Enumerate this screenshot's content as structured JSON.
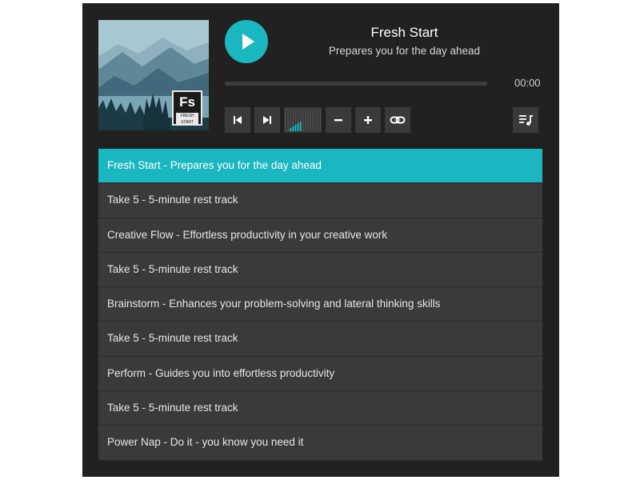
{
  "album": {
    "badge_letters": "Fs",
    "badge_caption": "FRESH START"
  },
  "now_playing": {
    "title": "Fresh Start",
    "subtitle": "Prepares you for the day ahead",
    "time": "00:00",
    "progress_fraction": 0,
    "volume_fraction": 0.5
  },
  "controls": {
    "play_icon": "play-icon",
    "prev_icon": "skip-previous-icon",
    "next_icon": "skip-next-icon",
    "volume_down_icon": "minus-icon",
    "volume_up_icon": "plus-icon",
    "loop_icon": "loop-icon",
    "playlist_icon": "playlist-music-icon"
  },
  "colors": {
    "accent": "#1ab7c1",
    "panel": "#212121",
    "row": "#3a3a3a"
  },
  "playlist": [
    {
      "label": "Fresh Start - Prepares you for the day ahead",
      "active": true
    },
    {
      "label": "Take 5 - 5-minute rest track",
      "active": false
    },
    {
      "label": "Creative Flow - Effortless productivity in your creative work",
      "active": false
    },
    {
      "label": "Take 5 - 5-minute rest track",
      "active": false
    },
    {
      "label": "Brainstorm - Enhances your problem-solving and lateral thinking skills",
      "active": false
    },
    {
      "label": "Take 5 - 5-minute rest track",
      "active": false
    },
    {
      "label": "Perform - Guides you into effortless productivity",
      "active": false
    },
    {
      "label": "Take 5 - 5-minute rest track",
      "active": false
    },
    {
      "label": "Power Nap - Do it - you know you need it",
      "active": false
    }
  ]
}
